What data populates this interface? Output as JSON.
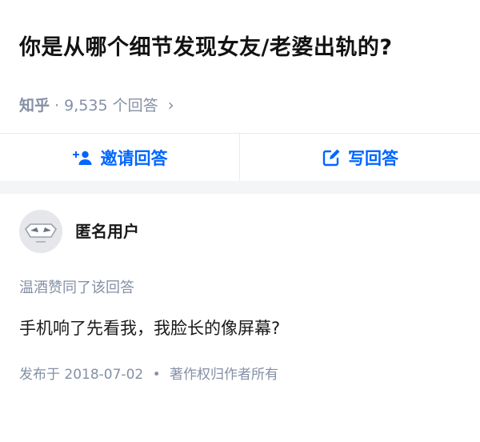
{
  "question": {
    "title": "你是从哪个细节发现女友/老婆出轨的?",
    "source": "知乎",
    "separator": "·",
    "answer_count": "9,535 个回答",
    "chevron": "›"
  },
  "actions": {
    "invite_label": "邀请回答",
    "invite_icon": "add-user-icon",
    "write_label": "写回答",
    "write_icon": "edit-icon",
    "accent_color": "#0066ff"
  },
  "answer": {
    "author": "匿名用户",
    "avatar_icon": "anonymous-mask-avatar",
    "upvote_note": "温酒赞同了该回答",
    "content": "手机响了先看我，我脸长的像屏幕?",
    "published": "发布于 2018-07-02",
    "dot": "•",
    "copyright": "著作权归作者所有"
  }
}
